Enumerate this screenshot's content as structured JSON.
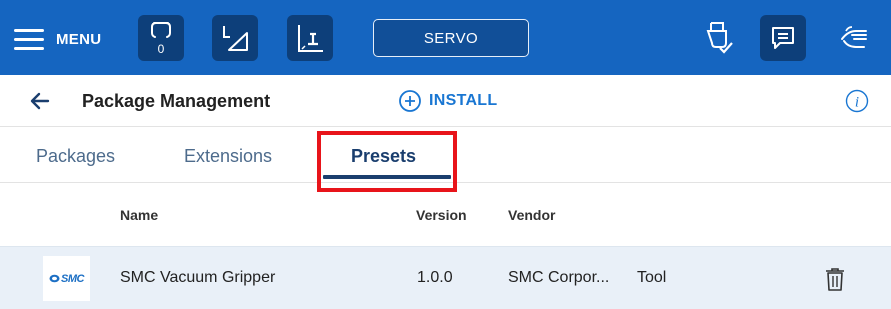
{
  "topbar": {
    "menu_label": "MENU",
    "icons": [
      "gripper-icon",
      "cartesian-jog-icon",
      "joint-jog-icon"
    ],
    "gripper_badge": "0",
    "servo_label": "SERVO",
    "right_icons": [
      "usb-check-icon",
      "chat-icon",
      "hand-guide-icon"
    ],
    "accent": "#1565c0"
  },
  "header": {
    "title": "Package Management",
    "install_label": "INSTALL"
  },
  "tabs": {
    "items": [
      {
        "label": "Packages",
        "active": false
      },
      {
        "label": "Extensions",
        "active": false
      },
      {
        "label": "Presets",
        "active": true
      }
    ]
  },
  "table": {
    "columns": [
      "Name",
      "Version",
      "Vendor"
    ],
    "rows": [
      {
        "logo_text": "SMC",
        "name": "SMC Vacuum Gripper",
        "version": "1.0.0",
        "vendor": "SMC Corpor...",
        "type": "Tool"
      }
    ]
  }
}
